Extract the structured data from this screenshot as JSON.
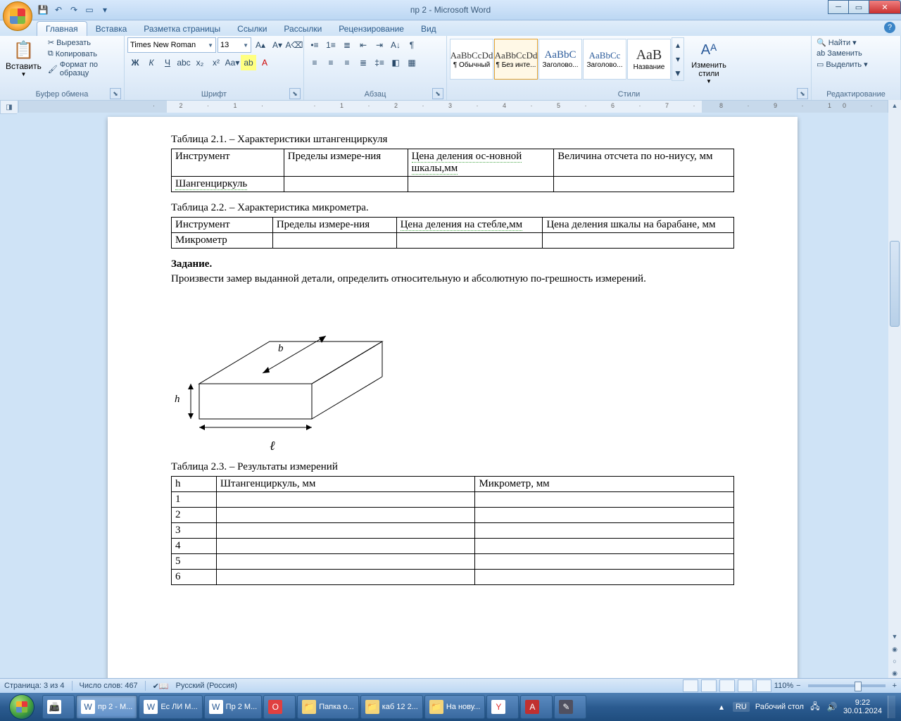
{
  "window": {
    "title": "пр 2 - Microsoft Word"
  },
  "qat": {
    "save": "💾",
    "undo": "↶",
    "redo": "↷",
    "new": "▭"
  },
  "tabs": [
    "Главная",
    "Вставка",
    "Разметка страницы",
    "Ссылки",
    "Рассылки",
    "Рецензирование",
    "Вид"
  ],
  "active_tab": 0,
  "clipboard": {
    "paste": "Вставить",
    "cut": "Вырезать",
    "copy": "Копировать",
    "format": "Формат по образцу",
    "group": "Буфер обмена"
  },
  "font": {
    "group": "Шрифт",
    "name": "Times New Roman",
    "size": "13"
  },
  "paragraph": {
    "group": "Абзац"
  },
  "styles": {
    "group": "Стили",
    "change": "Изменить стили",
    "items": [
      {
        "preview": "AaBbCcDd",
        "name": "¶ Обычный"
      },
      {
        "preview": "AaBbCcDd",
        "name": "¶ Без инте..."
      },
      {
        "preview": "AaBbC",
        "name": "Заголово..."
      },
      {
        "preview": "AaBbCc",
        "name": "Заголово..."
      },
      {
        "preview": "АаВ",
        "name": "Название"
      }
    ]
  },
  "editing": {
    "group": "Редактирование",
    "find": "Найти",
    "replace": "Заменить",
    "select": "Выделить"
  },
  "doc": {
    "t21_caption": "Таблица 2.1. – Характеристики штангенциркуля",
    "t21": {
      "h1": "Инструмент",
      "h2": "Пределы измере-ния",
      "h3": "Цена деления ос-новной шкалы,мм",
      "h4": "Величина отсчета по но-ниусу, мм",
      "r1": "Шангенциркуль"
    },
    "t22_caption": "Таблица 2.2. – Характеристика микрометра.",
    "t22": {
      "h1": "Инструмент",
      "h2": "Пределы измере-ния",
      "h3": "Цена деления на стебле,мм",
      "h4": "Цена деления шкалы на барабане, мм",
      "r1": "Микрометр"
    },
    "task_title": "Задание.",
    "task_text": "Произвести замер выданной детали, определить относительную и абсолютную по-грешность измерений.",
    "fig": {
      "b": "b",
      "h": "h",
      "l": "ℓ"
    },
    "t23_caption": "Таблица 2.3. – Результаты измерений",
    "t23": {
      "h1": "h",
      "h2": "Штангенциркуль, мм",
      "h3": "Микрометр, мм",
      "rows": [
        "1",
        "2",
        "3",
        "4",
        "5",
        "6"
      ]
    }
  },
  "status": {
    "page": "Страница: 3 из 4",
    "words": "Число слов: 467",
    "lang": "Русский (Россия)",
    "zoom": "110%"
  },
  "taskbar": {
    "pinned": [
      {
        "ic": "📠"
      }
    ],
    "items": [
      {
        "ic": "W",
        "label": "пр 2 - M...",
        "active": true
      },
      {
        "ic": "W",
        "label": "Ес ЛИ М..."
      },
      {
        "ic": "W",
        "label": "Пр 2 М..."
      },
      {
        "ic": "O",
        "label": ""
      },
      {
        "ic": "📁",
        "label": "Папка о..."
      },
      {
        "ic": "📁",
        "label": "каб 12 2..."
      },
      {
        "ic": "📁",
        "label": "На нову..."
      },
      {
        "ic": "Y",
        "label": ""
      },
      {
        "ic": "A",
        "label": ""
      },
      {
        "ic": "✎",
        "label": ""
      }
    ],
    "tray": {
      "lang": "RU",
      "desktop": "Рабочий стол",
      "time": "9:22",
      "date": "30.01.2024"
    }
  }
}
